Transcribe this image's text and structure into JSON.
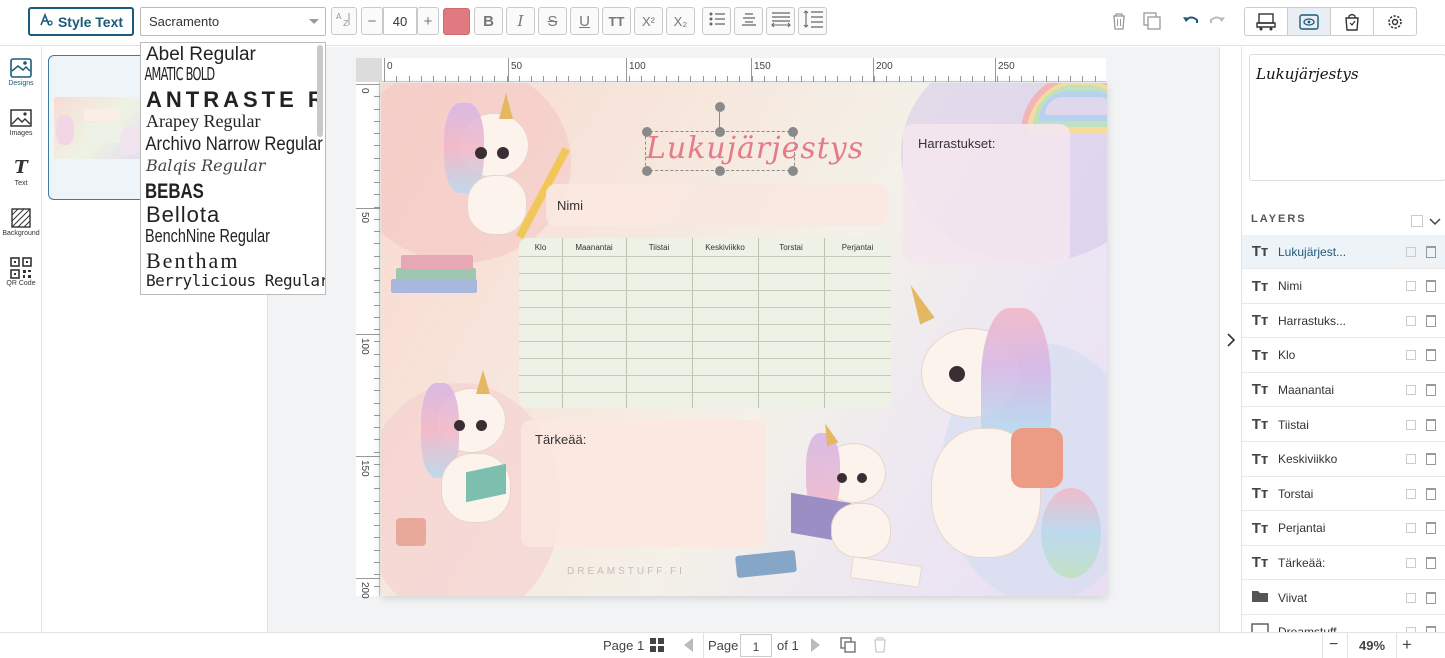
{
  "toolbar": {
    "style_text_label": "Style Text",
    "font_value": "Sacramento",
    "font_size": "40",
    "text_color": "#e07a80",
    "buttons": [
      "text-spacing",
      "decrease-size",
      "increase-size",
      "bold",
      "italic",
      "strikethrough",
      "underline",
      "uppercase",
      "superscript",
      "subscript",
      "bullet-list",
      "align-center",
      "letter-spacing",
      "line-height"
    ],
    "bold_glyph": "B",
    "italic_glyph": "I",
    "strike_glyph": "S",
    "underline_glyph": "U",
    "caps_glyph": "TT",
    "sup_glyph": "X²",
    "sub_glyph": "X₂",
    "minus_glyph": "−",
    "plus_glyph": "+"
  },
  "font_dropdown": [
    {
      "label": "Abel Regular"
    },
    {
      "label": "AMATIC BOLD"
    },
    {
      "label": "ANTRASTE REG"
    },
    {
      "label": "Arapey Regular"
    },
    {
      "label": "Archivo Narrow Regular"
    },
    {
      "label": "Balqis Regular"
    },
    {
      "label": "BEBAS"
    },
    {
      "label": "Bellota"
    },
    {
      "label": "BenchNine Regular"
    },
    {
      "label": "Bentham"
    },
    {
      "label": "Berrylicious Regular"
    }
  ],
  "left_nav": [
    {
      "label": "Designs",
      "icon": "designs-icon"
    },
    {
      "label": "Images",
      "icon": "images-icon"
    },
    {
      "label": "Text",
      "icon": "text-icon"
    },
    {
      "label": "Background",
      "icon": "background-icon"
    },
    {
      "label": "QR Code",
      "icon": "qr-code-icon"
    }
  ],
  "ruler": {
    "h_labels": [
      "0",
      "50",
      "100",
      "150",
      "200",
      "250"
    ],
    "v_labels": [
      "0",
      "50",
      "100",
      "150",
      "200"
    ]
  },
  "canvas": {
    "title": "Lukujärjestys",
    "name_label": "Nimi",
    "hobbies_label": "Harrastukset:",
    "important_label": "Tärkeää:",
    "watermark": "DREAMSTUFF.FI",
    "table_headers": [
      "Klo",
      "Maanantai",
      "Tiistai",
      "Keskiviikko",
      "Torstai",
      "Perjantai"
    ],
    "table_rows": 8
  },
  "right_panel": {
    "preview_text": "Lukujärjestys",
    "layers_title": "LAYERS",
    "layers": [
      {
        "label": "Lukujärjest...",
        "type": "text",
        "active": true
      },
      {
        "label": "Nimi",
        "type": "text",
        "active": false
      },
      {
        "label": "Harrastuks...",
        "type": "text",
        "active": false
      },
      {
        "label": "Klo",
        "type": "text",
        "active": false
      },
      {
        "label": "Maanantai",
        "type": "text",
        "active": false
      },
      {
        "label": "Tiistai",
        "type": "text",
        "active": false
      },
      {
        "label": "Keskiviikko",
        "type": "text",
        "active": false
      },
      {
        "label": "Torstai",
        "type": "text",
        "active": false
      },
      {
        "label": "Perjantai",
        "type": "text",
        "active": false
      },
      {
        "label": "Tärkeää:",
        "type": "text",
        "active": false
      },
      {
        "label": "Viivat",
        "type": "folder",
        "active": false
      },
      {
        "label": "Dreamstuff...",
        "type": "image",
        "active": false
      }
    ]
  },
  "bottom_bar": {
    "page_label_left": "Page 1",
    "page_word": "Page",
    "page_current": "1",
    "page_total": "of 1",
    "zoom": "49%",
    "zoom_minus": "−",
    "zoom_plus": "+"
  },
  "colors": {
    "brand": "#1b5a7a",
    "title_pink": "#e47b86"
  }
}
